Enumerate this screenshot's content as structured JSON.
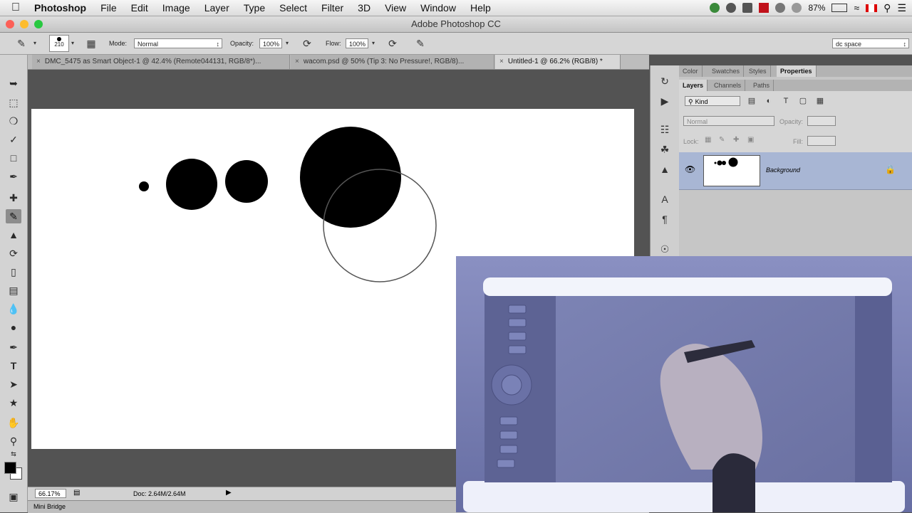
{
  "menubar": {
    "app": "Photoshop",
    "items": [
      "File",
      "Edit",
      "Image",
      "Layer",
      "Type",
      "Select",
      "Filter",
      "3D",
      "View",
      "Window",
      "Help"
    ],
    "battery": "87%"
  },
  "window": {
    "title": "Adobe Photoshop CC"
  },
  "options": {
    "brush_size": "210",
    "mode_label": "Mode:",
    "mode_value": "Normal",
    "opacity_label": "Opacity:",
    "opacity_value": "100%",
    "flow_label": "Flow:",
    "flow_value": "100%",
    "workspace": "dc space"
  },
  "doc_tabs": [
    {
      "label": "DMC_5475 as Smart Object-1 @ 42.4% (Remote044131, RGB/8*)...",
      "active": false
    },
    {
      "label": "wacom.psd @ 50% (Tip 3: No Pressure!, RGB/8)...",
      "active": false
    },
    {
      "label": "Untitled-1 @ 66.2% (RGB/8) *",
      "active": true
    }
  ],
  "statusbar": {
    "zoom": "66.17%",
    "doc": "Doc: 2.64M/2.64M"
  },
  "minibridge": {
    "label": "Mini Bridge"
  },
  "panels": {
    "top_tabs": [
      "Color",
      "Swatches",
      "Styles",
      "Properties"
    ],
    "layer_tabs": [
      "Layers",
      "Channels",
      "Paths"
    ],
    "kind_label": "Kind",
    "blend_mode": "Normal",
    "opacity_label": "Opacity:",
    "lock_label": "Lock:",
    "fill_label": "Fill:",
    "layer_name": "Background"
  },
  "colors": {
    "foreground": "#000000",
    "background": "#ffffff",
    "selection": "#a8b6d4"
  }
}
